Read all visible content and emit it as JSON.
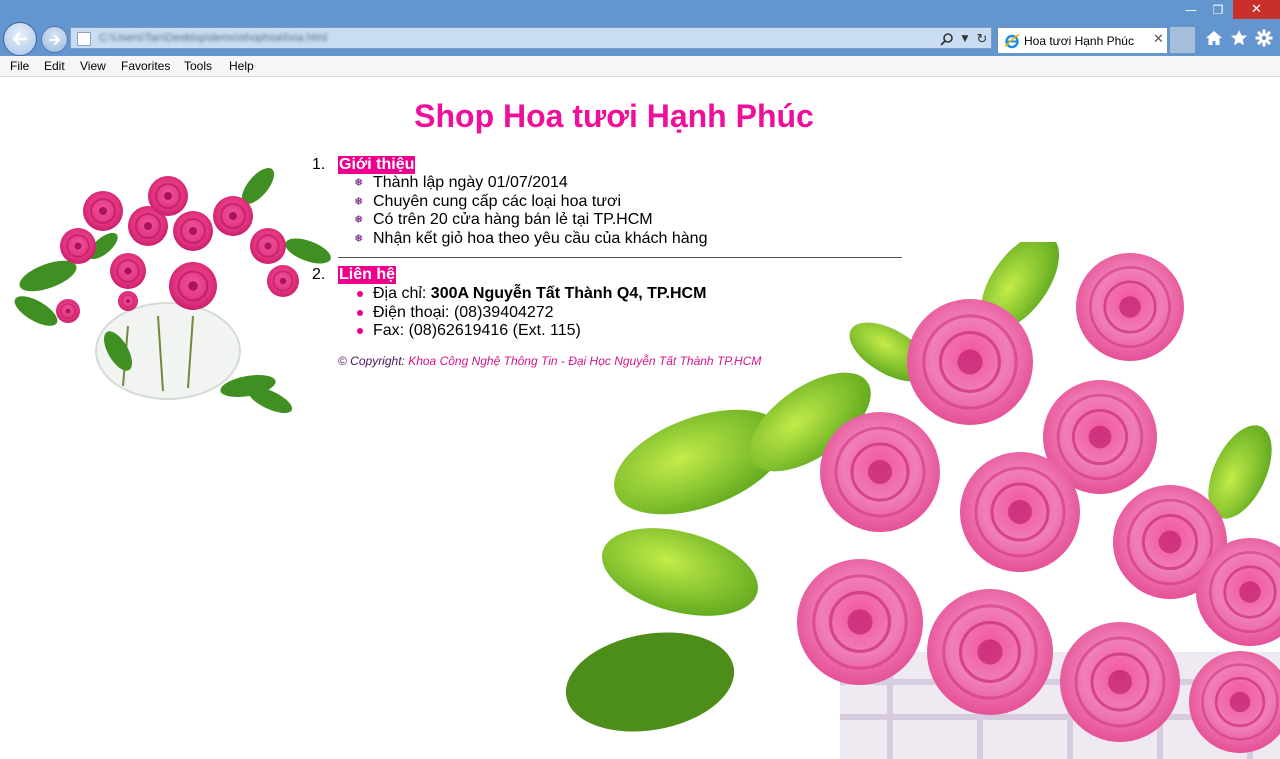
{
  "browser": {
    "window_buttons": {
      "minimize": "—",
      "restore": "❐",
      "close": "✕"
    },
    "address_bar": {
      "url": "C:\\Users\\Tan\\Desktop\\demo\\shophoa\\hoa.html"
    },
    "tab": {
      "title": "Hoa tươi Hạnh Phúc",
      "close": "✕"
    },
    "menu": [
      "File",
      "Edit",
      "View",
      "Favorites",
      "Tools",
      "Help"
    ],
    "icons": [
      "back-icon",
      "forward-icon",
      "search-icon",
      "dropdown-icon",
      "refresh-icon",
      "ie-icon",
      "home-icon",
      "favorites-star-icon",
      "gear-icon"
    ]
  },
  "page": {
    "heading": "Shop Hoa tươi Hạnh Phúc",
    "sections": [
      {
        "number": "1.",
        "title": "Giới thiệu",
        "bullet": "❅",
        "items": [
          "Thành lập ngày 01/07/2014",
          "Chuyên cung cấp các loại hoa tươi",
          "Có trên 20 cửa hàng bán lẻ tại TP.HCM",
          "Nhận kết giỏ hoa theo yêu cầu của khách hàng"
        ]
      },
      {
        "number": "2.",
        "title": "Liên hệ",
        "items": [
          {
            "label": "Địa chỉ: ",
            "value": "300A Nguyễn Tất Thành Q4, TP.HCM"
          },
          {
            "label": "Điện thoại: ",
            "value": "(08)39404272"
          },
          {
            "label": "Fax: ",
            "value": "(08)62619416 (Ext. 115)"
          }
        ]
      }
    ],
    "copyright": {
      "label": "© Copyright:",
      "owner": " Khoa Công Nghệ Thông Tin - Đại Học Nguyễn Tất Thành TP.HCM"
    }
  },
  "colors": {
    "chrome_blue": "#6396cf",
    "heading_pink": "#ee0f9b",
    "highlight_pink": "#ec008c",
    "copyright_purple": "#4a1660"
  }
}
